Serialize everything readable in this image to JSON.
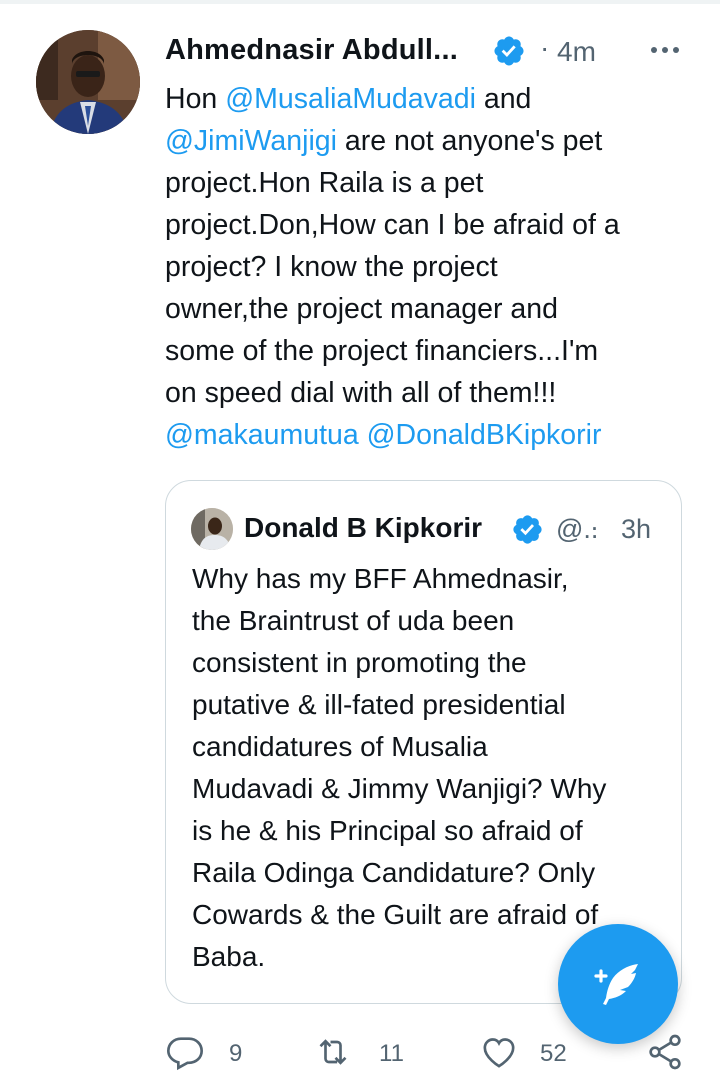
{
  "tweet": {
    "author_name": "Ahmednasir Abdull...",
    "timestamp": "4m",
    "separator": "·",
    "avatar_icon": "profile-photo",
    "verified_icon": "verified-badge-icon",
    "more_icon": "more-horizontal-icon",
    "text_lines": [
      [
        {
          "t": "Hon ",
          "m": false
        },
        {
          "t": "@MusaliaMudavadi",
          "m": true
        },
        {
          "t": " and",
          "m": false
        }
      ],
      [
        {
          "t": "@JimiWanjigi",
          "m": true
        },
        {
          "t": " are not anyone's pet",
          "m": false
        }
      ],
      [
        {
          "t": "project.Hon Raila is a pet",
          "m": false
        }
      ],
      [
        {
          "t": "project.Don,How can I be afraid of a",
          "m": false
        }
      ],
      [
        {
          "t": "project? I know the project",
          "m": false
        }
      ],
      [
        {
          "t": "owner,the project manager and",
          "m": false
        }
      ],
      [
        {
          "t": "some of the project financiers...I'm",
          "m": false
        }
      ],
      [
        {
          "t": "on speed dial with all of them!!!",
          "m": false
        }
      ],
      [
        {
          "t": "@makaumutua",
          "m": true
        },
        {
          "t": " ",
          "m": false
        },
        {
          "t": "@DonaldBKipkorir",
          "m": true
        }
      ]
    ]
  },
  "quote": {
    "author_name": "Donald B Kipkorir",
    "handle": "@..",
    "separator": "·",
    "timestamp": "3h",
    "text_lines": [
      "Why has my BFF Ahmednasir,",
      "the Braintrust of uda been",
      "consistent in promoting the",
      "putative & ill-fated presidential",
      "candidatures of Musalia",
      "Mudavadi & Jimmy Wanjigi? Why",
      "is he & his Principal so afraid of",
      "Raila Odinga Candidature? Only",
      "Cowards & the Guilt are afraid of",
      "Baba."
    ]
  },
  "actions": {
    "reply_count": "9",
    "retweet_count": "11",
    "like_count": "52",
    "icons": [
      "reply-icon",
      "retweet-icon",
      "like-icon",
      "share-icon"
    ]
  },
  "colors": {
    "accent": "#1d9bf0",
    "text": "#0f1419",
    "secondary": "#536471",
    "border": "#cfd9de"
  }
}
